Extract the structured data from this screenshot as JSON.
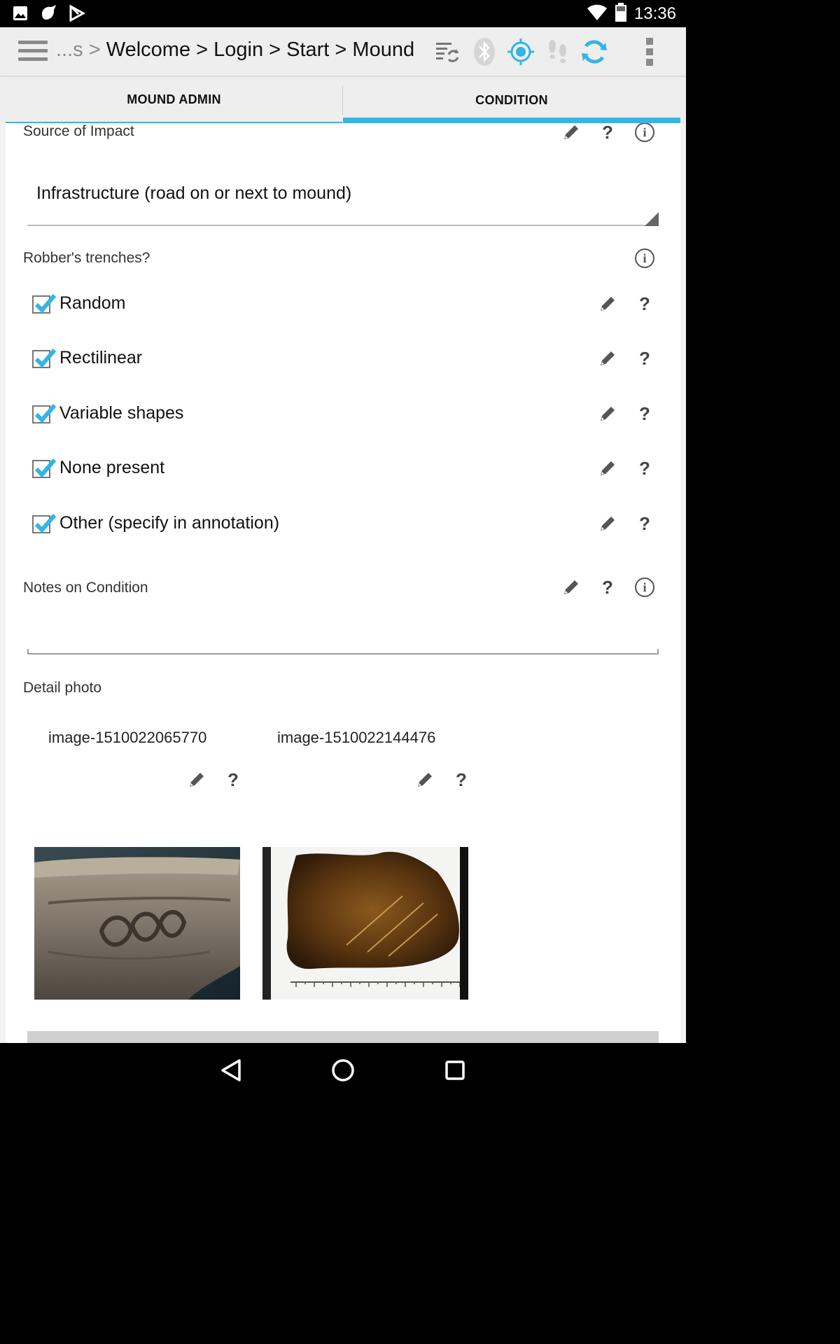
{
  "status_bar": {
    "time": "13:36",
    "left_icons": [
      "gallery-icon",
      "bird-app-icon",
      "play-store-icon"
    ],
    "right_icons": [
      "wifi-icon",
      "battery-icon"
    ]
  },
  "action_bar": {
    "breadcrumb_prefix": "...s >",
    "breadcrumb": "Welcome > Login > Start > Mound",
    "icons": [
      "sync-list-icon",
      "bluetooth-icon",
      "gps-icon",
      "tracking-footsteps-icon",
      "refresh-icon",
      "overflow-menu-icon"
    ],
    "colors": {
      "accent": "#33b5e5",
      "disabled": "#c8c8c8"
    }
  },
  "tabs": [
    {
      "label": "MOUND ADMIN",
      "selected": false
    },
    {
      "label": "CONDITION",
      "selected": true
    }
  ],
  "form": {
    "source_of_impact": {
      "label": "Source of Impact",
      "value": "Infrastructure (road on or next to mound)"
    },
    "robbers_trenches": {
      "label": "Robber's trenches?",
      "options": [
        {
          "label": "Random",
          "checked": true
        },
        {
          "label": "Rectilinear",
          "checked": true
        },
        {
          "label": "Variable shapes",
          "checked": true
        },
        {
          "label": "None present",
          "checked": true
        },
        {
          "label": "Other (specify in annotation)",
          "checked": true
        }
      ]
    },
    "notes_on_condition": {
      "label": "Notes on Condition",
      "value": ""
    },
    "detail_photo": {
      "label": "Detail photo",
      "photos": [
        {
          "name": "image-1510022065770"
        },
        {
          "name": "image-1510022144476"
        }
      ]
    }
  },
  "nav_bar": {
    "icons": [
      "back-icon",
      "home-icon",
      "recents-icon"
    ]
  }
}
